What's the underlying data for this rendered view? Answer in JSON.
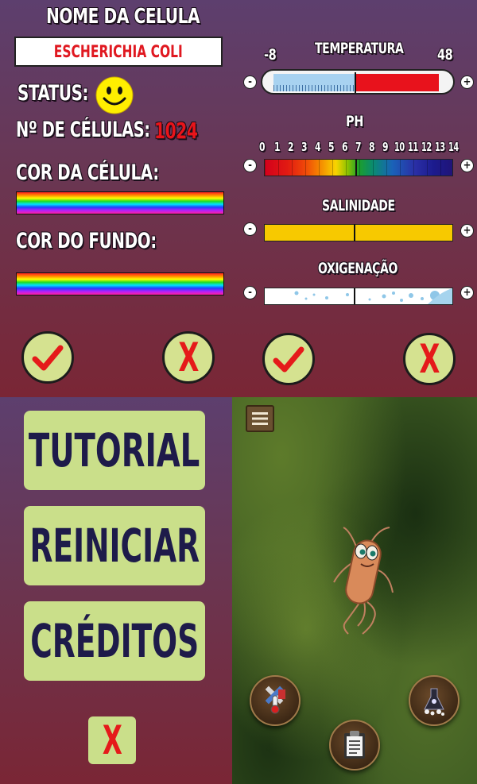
{
  "cell_panel": {
    "title": "NOME DA CELULA",
    "cell_name": "ESCHERICHIA COLI",
    "status_label": "STATUS:",
    "status_icon": "smiley-face-icon",
    "count_label": "Nº DE CÉLULAS:",
    "count_value": "1024",
    "cell_color_label": "COR DA CÉLULA:",
    "background_color_label": "COR DO FUNDO:",
    "confirm_icon": "checkmark-icon",
    "cancel_label": "X"
  },
  "environment_panel": {
    "temperature": {
      "title": "TEMPERATURA",
      "min": "-8",
      "max": "48",
      "minus": "-",
      "plus": "+"
    },
    "ph": {
      "title": "PH",
      "ticks": [
        "0",
        "1",
        "2",
        "3",
        "4",
        "5",
        "6",
        "7",
        "8",
        "9",
        "10",
        "11",
        "12",
        "13",
        "14"
      ],
      "minus": "-",
      "plus": "+"
    },
    "salinity": {
      "title": "SALINIDADE",
      "minus": "-",
      "plus": "+"
    },
    "oxygenation": {
      "title": "OXIGENAÇÃO",
      "minus": "-",
      "plus": "+"
    },
    "confirm_icon": "checkmark-icon",
    "cancel_label": "X"
  },
  "menu_panel": {
    "tutorial": "TUTORIAL",
    "restart": "REINICIAR",
    "credits": "CRÉDITOS",
    "close": "X"
  },
  "game_panel": {
    "menu_icon": "hamburger-menu-icon",
    "tools_icon": "thermometer-tools-icon",
    "clipboard_icon": "clipboard-icon",
    "chemistry_icon": "chemical-flask-icon"
  },
  "colors": {
    "accent_red": "#e01820",
    "button_green": "#cadf8a",
    "menu_text": "#1e1b4a"
  }
}
